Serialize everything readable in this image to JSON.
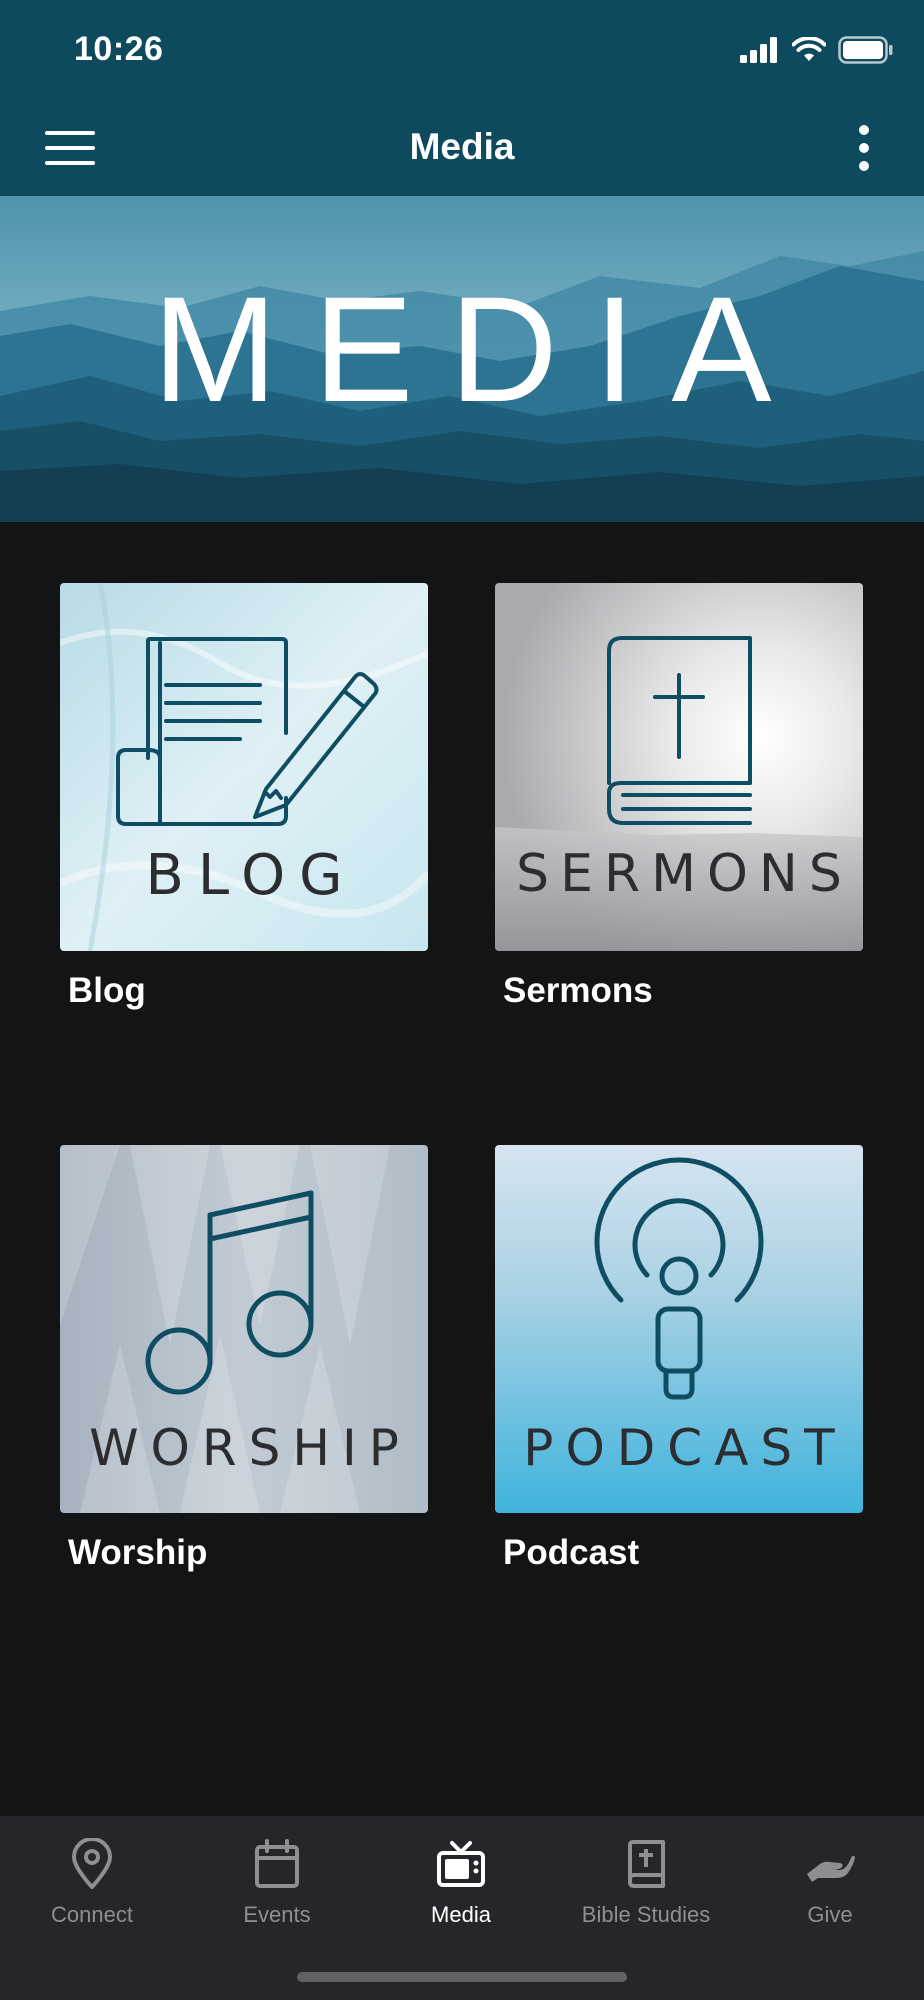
{
  "status_bar": {
    "time": "10:26"
  },
  "app_bar": {
    "title": "Media"
  },
  "banner": {
    "title": "MEDIA"
  },
  "tiles": [
    {
      "word": "BLOG",
      "label": "Blog"
    },
    {
      "word": "SERMONS",
      "label": "Sermons"
    },
    {
      "word": "WORSHIP",
      "label": "Worship"
    },
    {
      "word": "PODCAST",
      "label": "Podcast"
    }
  ],
  "tabbar": {
    "items": [
      {
        "label": "Connect",
        "icon": "map-pin-icon"
      },
      {
        "label": "Events",
        "icon": "calendar-icon"
      },
      {
        "label": "Media",
        "icon": "tv-icon",
        "active": true
      },
      {
        "label": "Bible Studies",
        "icon": "bible-icon"
      },
      {
        "label": "Give",
        "icon": "giving-hand-icon"
      }
    ]
  },
  "colors": {
    "brand": "#0e4a5e",
    "icon_teal": "#0f4d62",
    "background": "#131416",
    "tabbar": "#252629"
  }
}
